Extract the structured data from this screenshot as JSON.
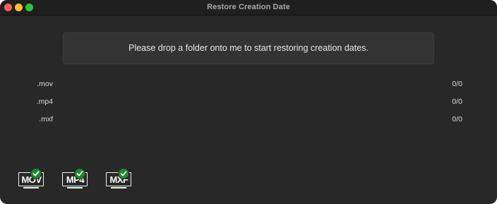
{
  "window": {
    "title": "Restore Creation Date"
  },
  "drop_zone": {
    "message": "Please drop a folder onto me to start restoring creation dates."
  },
  "file_types": [
    {
      "extension": ".mov",
      "count": "0/0"
    },
    {
      "extension": ".mp4",
      "count": "0/0"
    },
    {
      "extension": ".mxf",
      "count": "0/0"
    }
  ],
  "badges": [
    {
      "label": "MOV",
      "icon": "mov-check-icon"
    },
    {
      "label": "MP4",
      "icon": "mp4-check-icon"
    },
    {
      "label": "MXF",
      "icon": "mxf-check-icon"
    }
  ],
  "colors": {
    "window_bg": "#282828",
    "titlebar_bg": "#1f1f1f",
    "close": "#ff5f57",
    "minimize": "#febc2e",
    "zoom": "#28c840",
    "check_green": "#1a8a2c"
  }
}
